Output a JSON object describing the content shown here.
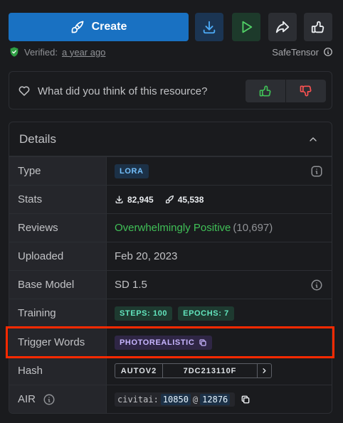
{
  "toolbar": {
    "create_label": "Create",
    "buttons": [
      "download-icon",
      "play-icon",
      "share-icon",
      "thumbs-up-icon"
    ]
  },
  "verified": {
    "label": "Verified:",
    "time": "a year ago",
    "format": "SafeTensor"
  },
  "feedback": {
    "question": "What did you think of this resource?"
  },
  "details": {
    "title": "Details",
    "rows": {
      "type": {
        "label": "Type",
        "value": "LORA"
      },
      "stats": {
        "label": "Stats",
        "downloads": "82,945",
        "generations": "45,538"
      },
      "reviews": {
        "label": "Reviews",
        "value": "Overwhelmingly Positive",
        "count": "(10,697)"
      },
      "uploaded": {
        "label": "Uploaded",
        "value": "Feb 20, 2023"
      },
      "base_model": {
        "label": "Base Model",
        "value": "SD 1.5"
      },
      "training": {
        "label": "Training",
        "steps": "STEPS: 100",
        "epochs": "EPOCHS: 7"
      },
      "trigger_words": {
        "label": "Trigger Words",
        "value": "PHOTOREALISTIC"
      },
      "hash": {
        "label": "Hash",
        "type": "AUTOV2",
        "value": "7DC213110F"
      },
      "air": {
        "label": "AIR",
        "prefix": "civitai:",
        "model_id": "10850",
        "at": "@",
        "version_id": "12876"
      }
    }
  },
  "colors": {
    "accent": "#1971c2",
    "positive": "#40c057",
    "highlight": "#ff2a00"
  }
}
